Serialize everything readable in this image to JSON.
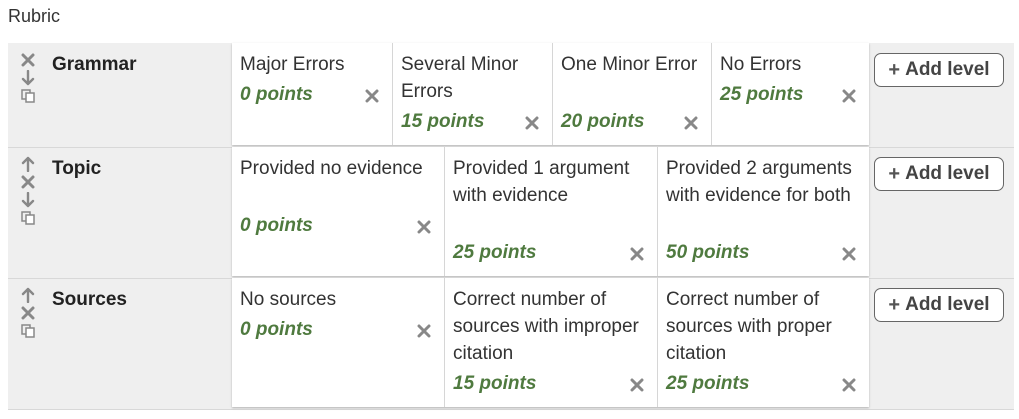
{
  "title": "Rubric",
  "add_level_label": "Add level",
  "criteria": [
    {
      "name": "Grammar",
      "levels": [
        {
          "description": "Major Errors",
          "points": "0 points"
        },
        {
          "description": "Several Minor Errors",
          "points": "15 points"
        },
        {
          "description": "One Minor Error",
          "points": "20 points"
        },
        {
          "description": "No Errors",
          "points": "25 points"
        }
      ]
    },
    {
      "name": "Topic",
      "levels": [
        {
          "description": "Provided no evidence",
          "points": "0 points"
        },
        {
          "description": "Provided 1 argument with evidence",
          "points": "25 points"
        },
        {
          "description": "Provided 2 arguments with evidence for both",
          "points": "50 points"
        }
      ]
    },
    {
      "name": "Sources",
      "levels": [
        {
          "description": "No sources",
          "points": "0 points"
        },
        {
          "description": "Correct number of sources with improper citation",
          "points": "15 points"
        },
        {
          "description": "Correct number of sources with proper citation",
          "points": "25 points"
        }
      ]
    }
  ],
  "colors": {
    "points": "#4f7a3f",
    "panel": "#efefef",
    "icon": "#888888"
  }
}
